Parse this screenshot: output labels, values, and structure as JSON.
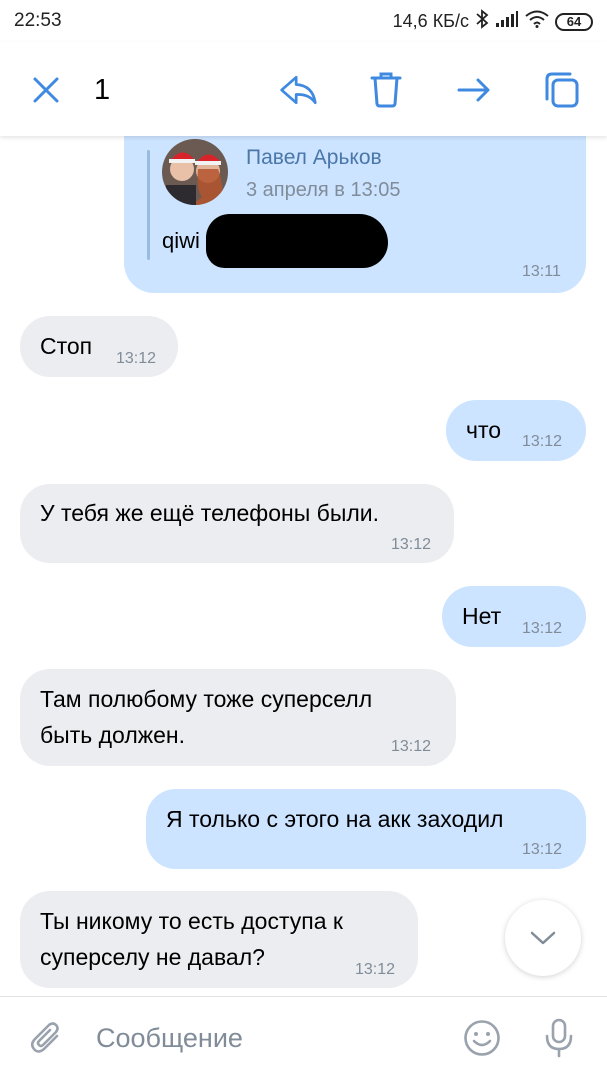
{
  "status_bar": {
    "time": "22:53",
    "speed": "14,6 КБ/с",
    "battery": "64",
    "icons": [
      "bluetooth-icon",
      "signal-icon",
      "wifi-icon",
      "battery-icon"
    ]
  },
  "toolbar": {
    "selected_count": "1",
    "icons": [
      "close-icon",
      "reply-icon",
      "delete-icon",
      "forward-icon",
      "copy-icon"
    ]
  },
  "forwarded": {
    "author": "Павел Арьков",
    "date": "3 апреля в 13:05",
    "text": "qiwi",
    "time": "13:11"
  },
  "messages": [
    {
      "direction": "in",
      "lines": [
        "Стоп"
      ],
      "time": "13:12"
    },
    {
      "direction": "out",
      "lines": [
        "что"
      ],
      "time": "13:12"
    },
    {
      "direction": "in",
      "lines": [
        "У тебя же ещё телефоны были."
      ],
      "time": "13:12"
    },
    {
      "direction": "out",
      "lines": [
        "Нет"
      ],
      "time": "13:12"
    },
    {
      "direction": "in",
      "lines": [
        "Там полюбому тоже суперселл",
        "быть должен."
      ],
      "time": "13:12"
    },
    {
      "direction": "out",
      "lines": [
        "Я только с этого на акк заходил"
      ],
      "time": "13:12"
    },
    {
      "direction": "in",
      "lines": [
        "Ты никому то есть доступа к",
        "суперселу не давал?"
      ],
      "time": "13:12"
    }
  ],
  "composer": {
    "placeholder": "Сообщение",
    "icons": [
      "attach-icon",
      "emoji-icon",
      "microphone-icon"
    ]
  },
  "colors": {
    "accent": "#3f8ae0",
    "incoming_bubble": "#ebedf0",
    "outgoing_bubble": "#cce4ff",
    "timestamp": "#818c99",
    "author_name": "#4a76a8"
  }
}
